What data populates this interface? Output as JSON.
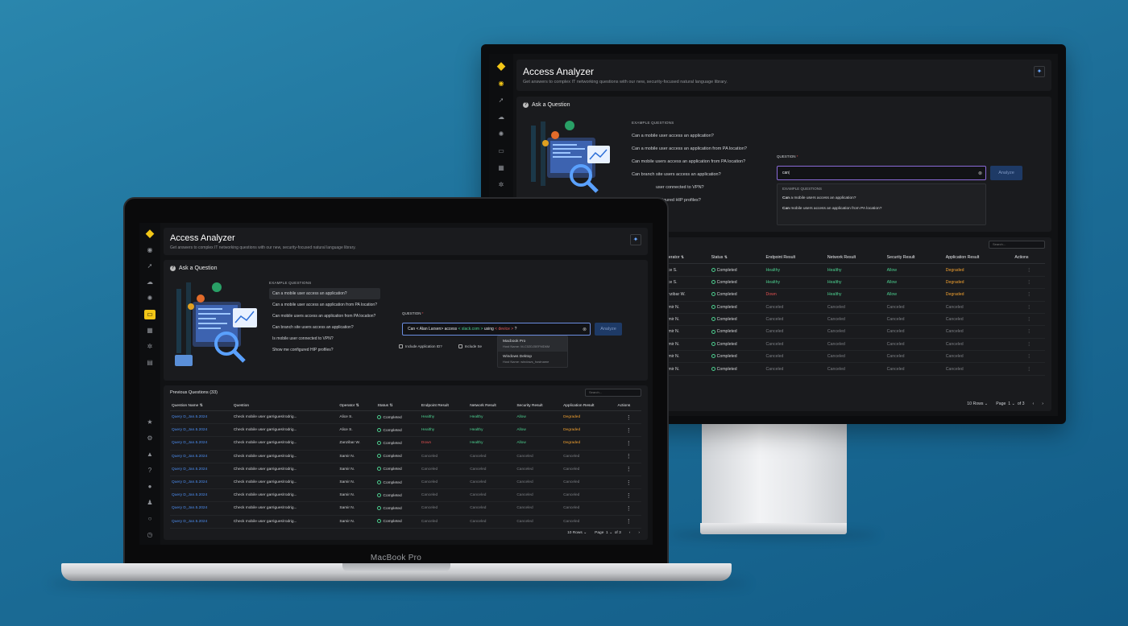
{
  "device": {
    "laptop_brand": "MacBook Pro"
  },
  "app": {
    "title": "Access Analyzer",
    "subtitle": "Get answers to complex IT networking questions with our new, security-focused natural language library.",
    "ask_title": "Ask a Question",
    "examples_label": "EXAMPLE QUESTIONS",
    "examples": [
      "Can a mobile user access an application?",
      "Can a mobile user access an application from PA location?",
      "Can mobile users access an application from PA location?",
      "Can branch site users access an application?",
      "Is mobile user connected to VPN?",
      "Show me configured HIP profiles?"
    ],
    "question_label": "QUESTION",
    "required_mark": "*",
    "analyze_label": "Analyze",
    "clear_icon": "⊗"
  },
  "laptop": {
    "query_tokens": {
      "t1": "Can",
      "t2": "< Alan Larsen>",
      "t3": "access",
      "t4": "< slack.com >",
      "t5": "using",
      "t6": "< device >",
      "t7": "?"
    },
    "include_app_id": "Include Application ID?",
    "include_second": "Include Se",
    "device_dropdown": [
      {
        "name": "Macbook Pro",
        "host": "Host Name: M-C02DJ5EFMD6M"
      },
      {
        "name": "Windows Dektop",
        "host": "Host Name: windows_hostname"
      }
    ],
    "table_title": "Previous Questions (33)",
    "search_placeholder": "Search...",
    "columns": [
      "Question Name",
      "Question",
      "Operator",
      "Status",
      "Endpoint Result",
      "Network Result",
      "Security Result",
      "Application Result",
      "Actions"
    ],
    "rows": [
      [
        "Query D_Jan.5.2024",
        "Check mobile user garrigues\\rodrig...",
        "Alice S.",
        "Completed",
        "Healthy",
        "Healthy",
        "Allow",
        "Degraded"
      ],
      [
        "Query D_Jan.5.2024",
        "Check mobile user garrigues\\rodrig...",
        "Alice S.",
        "Completed",
        "Healthy",
        "Healthy",
        "Allow",
        "Degraded"
      ],
      [
        "Query D_Jan.5.2024",
        "Check mobile user garrigues\\rodrig...",
        "Zanzibar W.",
        "Completed",
        "Down",
        "Healthy",
        "Allow",
        "Degraded"
      ],
      [
        "Query D_Jan.5.2024",
        "Check mobile user garrigues\\rodrig...",
        "Samir N.",
        "Completed",
        "Canceled",
        "Canceled",
        "Canceled",
        "Canceled"
      ],
      [
        "Query D_Jan.5.2024",
        "Check mobile user garrigues\\rodrig...",
        "Samir N.",
        "Completed",
        "Canceled",
        "Canceled",
        "Canceled",
        "Canceled"
      ],
      [
        "Query D_Jan.5.2024",
        "Check mobile user garrigues\\rodrig...",
        "Samir N.",
        "Completed",
        "Canceled",
        "Canceled",
        "Canceled",
        "Canceled"
      ],
      [
        "Query D_Jan.5.2024",
        "Check mobile user garrigues\\rodrig...",
        "Samir N.",
        "Completed",
        "Canceled",
        "Canceled",
        "Canceled",
        "Canceled"
      ],
      [
        "Query D_Jan.5.2024",
        "Check mobile user garrigues\\rodrig...",
        "Samir N.",
        "Completed",
        "Canceled",
        "Canceled",
        "Canceled",
        "Canceled"
      ],
      [
        "Query D_Jan.5.2024",
        "Check mobile user garrigues\\rodrig...",
        "Samir N.",
        "Completed",
        "Canceled",
        "Canceled",
        "Canceled",
        "Canceled"
      ]
    ],
    "pager": {
      "rows": "10 Rows",
      "page_label": "Page",
      "page": "1",
      "of": "of 3"
    }
  },
  "monitor": {
    "query_value": "can",
    "suggest_label": "EXAMPLE QUESTIONS",
    "suggestions": [
      {
        "bold": "Can",
        "rest": " a mobile users access an application?"
      },
      {
        "bold": "Can",
        "rest": " mobile users access an application from PA location?"
      }
    ],
    "search_placeholder": "Search...",
    "visible_examples": [
      "Can a mobile user access an application?",
      "Can a mobile user access an application from PA location?",
      "Can mobile users access an application from PA location?",
      "Can branch site users access an application?",
      "user connected to VPN?",
      "onfigured HIP profiles?"
    ],
    "columns": [
      "Operator",
      "Status",
      "Endpoint Result",
      "Network Result",
      "Security Result",
      "Application Result",
      "Actions"
    ],
    "rows": [
      [
        "Alice S.",
        "Completed",
        "Healthy",
        "Healthy",
        "Allow",
        "Degraded"
      ],
      [
        "Alice S.",
        "Completed",
        "Healthy",
        "Healthy",
        "Allow",
        "Degraded"
      ],
      [
        "Zanzibar W.",
        "Completed",
        "Down",
        "Healthy",
        "Allow",
        "Degraded"
      ],
      [
        "Samir N.",
        "Completed",
        "Canceled",
        "Canceled",
        "Canceled",
        "Canceled"
      ],
      [
        "Samir N.",
        "Completed",
        "Canceled",
        "Canceled",
        "Canceled",
        "Canceled"
      ],
      [
        "Samir N.",
        "Completed",
        "Canceled",
        "Canceled",
        "Canceled",
        "Canceled"
      ],
      [
        "Samir N.",
        "Completed",
        "Canceled",
        "Canceled",
        "Canceled",
        "Canceled"
      ],
      [
        "Samir N.",
        "Completed",
        "Canceled",
        "Canceled",
        "Canceled",
        "Canceled"
      ],
      [
        "Samir N.",
        "Completed",
        "Canceled",
        "Canceled",
        "Canceled",
        "Canceled"
      ]
    ],
    "pager": {
      "rows": "10 Rows",
      "page_label": "Page",
      "page": "1",
      "of": "of 3"
    }
  },
  "icons": {
    "logo": "logo-icon",
    "sort": "⇅",
    "chevron": "⌄",
    "kebab": "⋮",
    "prev": "‹",
    "next": "›"
  },
  "colors": {
    "accent": "#f2c617",
    "healthy": "#4ccf8f",
    "degraded": "#f0a030",
    "down": "#e05050",
    "link": "#4c8df0"
  }
}
